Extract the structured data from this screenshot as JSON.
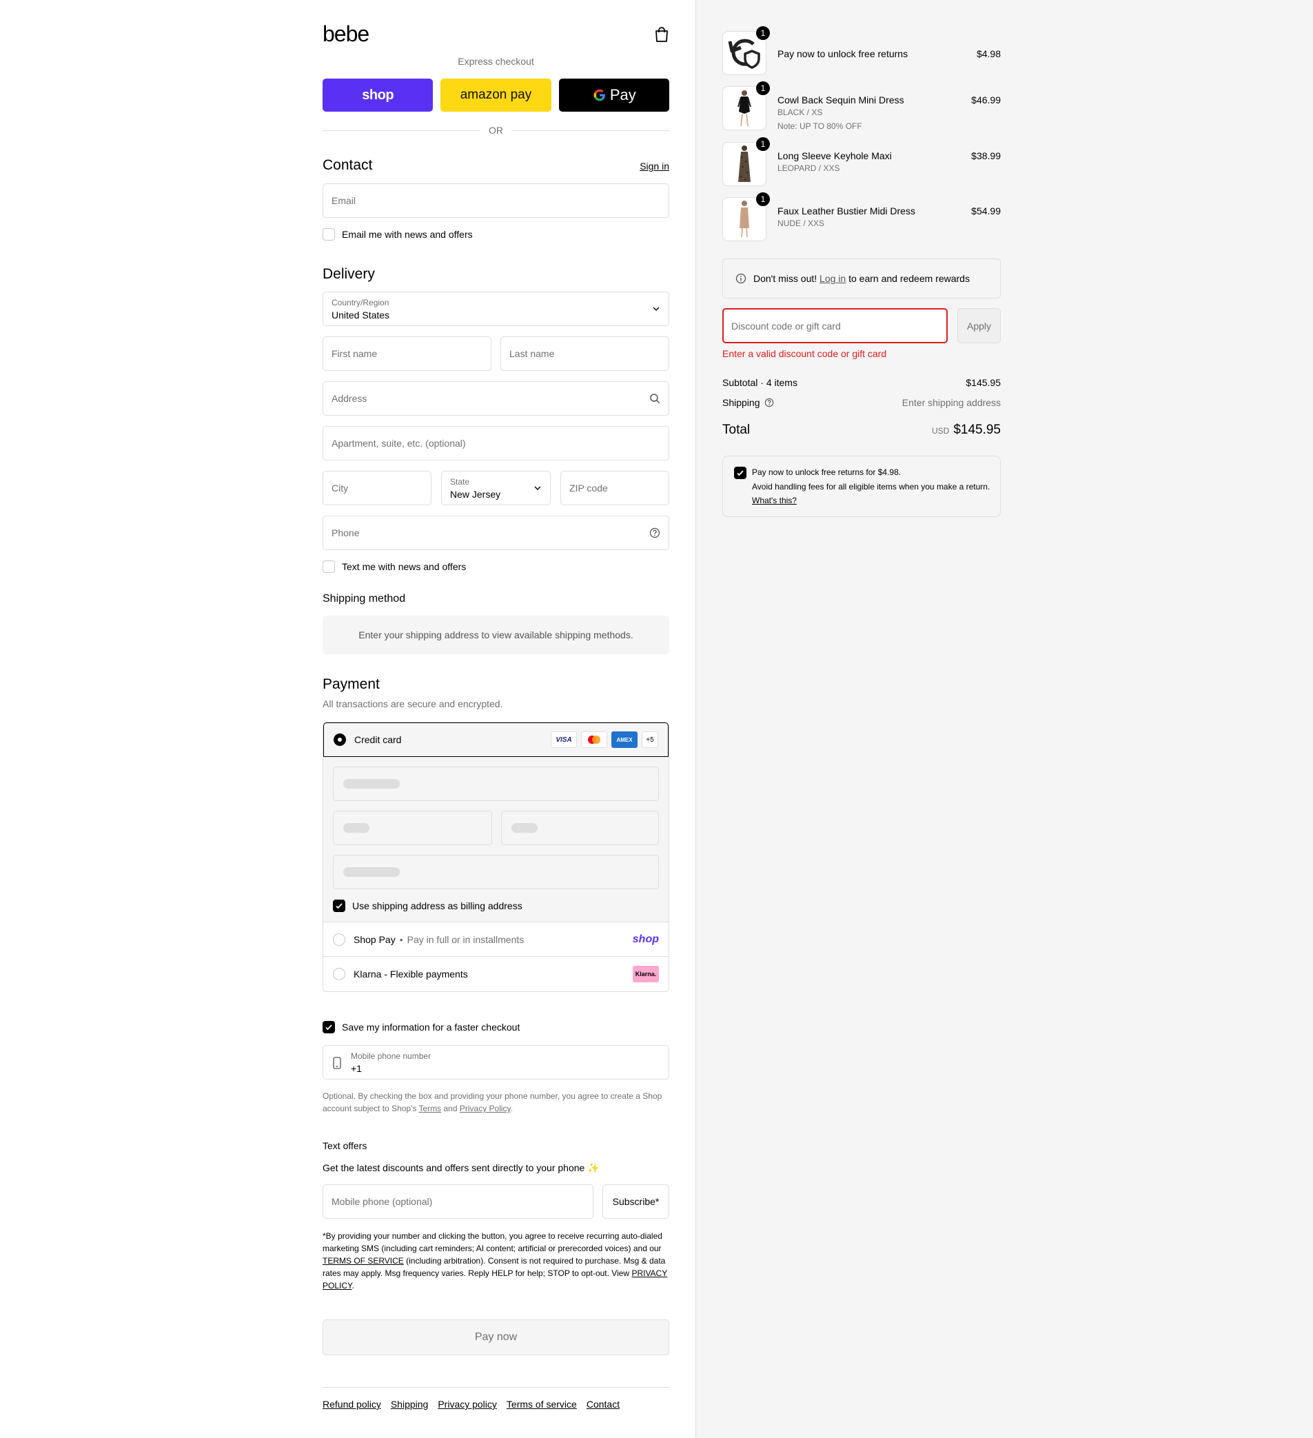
{
  "brand": "bebe",
  "express": {
    "title": "Express checkout",
    "shop": "shop",
    "amazon": "amazon pay",
    "gpay": "Pay",
    "or": "OR"
  },
  "contact": {
    "title": "Contact",
    "sign_in": "Sign in",
    "email_placeholder": "Email",
    "email_news": "Email me with news and offers"
  },
  "delivery": {
    "title": "Delivery",
    "country_label": "Country/Region",
    "country_value": "United States",
    "first_name": "First name",
    "last_name": "Last name",
    "address": "Address",
    "apartment": "Apartment, suite, etc. (optional)",
    "city": "City",
    "state_label": "State",
    "state_value": "New Jersey",
    "zip": "ZIP code",
    "phone": "Phone",
    "text_news": "Text me with news and offers"
  },
  "shipping_method": {
    "title": "Shipping method",
    "info": "Enter your shipping address to view available shipping methods."
  },
  "payment": {
    "title": "Payment",
    "subtitle": "All transactions are secure and encrypted.",
    "credit_card": "Credit card",
    "card_visa": "VISA",
    "card_amex": "AMEX",
    "more_cards": "+5",
    "billing_same": "Use shipping address as billing address",
    "shop_pay": "Shop Pay",
    "shop_pay_desc": "Pay in full or in installments",
    "shop_pay_logo": "shop",
    "klarna": "Klarna - Flexible payments",
    "klarna_logo": "Klarna."
  },
  "remember": {
    "save_label": "Save my information for a faster checkout",
    "mobile_label": "Mobile phone number",
    "mobile_value": "+1",
    "legal_1": "Optional. By checking the box and providing your phone number, you agree to create a Shop account subject to Shop's ",
    "terms": "Terms",
    "and": " and ",
    "privacy": "Privacy Policy",
    "period": "."
  },
  "text_offers": {
    "title": "Text offers",
    "desc": "Get the latest discounts and offers sent directly to your phone ✨",
    "mobile_placeholder": "Mobile phone (optional)",
    "subscribe": "Subscribe*",
    "legal_1": "*By providing your number and clicking the button, you agree to receive recurring auto-dialed marketing SMS (including cart reminders; AI content; artificial or prerecorded voices) and our ",
    "tos": "TERMS OF SERVICE",
    "legal_2": " (including arbitration). Consent is not required to purchase. Msg & data rates may apply. Msg frequency varies. Reply HELP for help; STOP to opt-out. View ",
    "privacy": "PRIVACY POLICY",
    "period": "."
  },
  "pay_now": "Pay now",
  "footer_links": [
    "Refund policy",
    "Shipping",
    "Privacy policy",
    "Terms of service",
    "Contact"
  ],
  "cart": {
    "items": [
      {
        "name": "Pay now to unlock free returns",
        "variant": "",
        "note": "",
        "price": "$4.98",
        "qty": "1"
      },
      {
        "name": "Cowl Back Sequin Mini Dress",
        "variant": "BLACK / XS",
        "note": "Note: UP TO 80% OFF",
        "price": "$46.99",
        "qty": "1"
      },
      {
        "name": "Long Sleeve Keyhole Maxi",
        "variant": "LEOPARD / XXS",
        "note": "",
        "price": "$38.99",
        "qty": "1"
      },
      {
        "name": "Faux Leather Bustier Midi Dress",
        "variant": "NUDE / XXS",
        "note": "",
        "price": "$54.99",
        "qty": "1"
      }
    ],
    "rewards_pre": "Don't miss out! ",
    "rewards_link": "Log in",
    "rewards_post": " to earn and redeem rewards",
    "discount_placeholder": "Discount code or gift card",
    "apply": "Apply",
    "error": "Enter a valid discount code or gift card",
    "subtotal_label": "Subtotal · 4 items",
    "subtotal_value": "$145.95",
    "shipping_label": "Shipping",
    "shipping_value": "Enter shipping address",
    "total_label": "Total",
    "currency": "USD",
    "total_value": "$145.95",
    "returns_title": "Pay now to unlock free returns for $4.98.",
    "returns_desc": "Avoid handling fees for all eligible items when you make a return.",
    "returns_link": "What's this?"
  },
  "colors": {
    "shop_purple": "#5a31f4",
    "amazon_yellow": "#ffd814",
    "error_red": "#dd1d1d",
    "klarna_pink": "#ffa8cd"
  }
}
